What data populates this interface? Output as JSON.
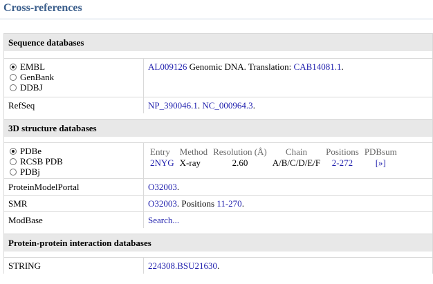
{
  "page_title": "Cross-references",
  "sections": [
    {
      "title": "Sequence databases",
      "rows": [
        {
          "radios": [
            {
              "label": "EMBL",
              "checked": true
            },
            {
              "label": "GenBank",
              "checked": false
            },
            {
              "label": "DDBJ",
              "checked": false
            }
          ],
          "link1": "AL009126",
          "text1": " Genomic DNA. Translation: ",
          "link2": "CAB14081.1",
          "text2": "."
        },
        {
          "label": "RefSeq",
          "link1": "NP_390046.1",
          "text1": ". ",
          "link2": "NC_000964.3",
          "text2": "."
        }
      ]
    },
    {
      "title": "3D structure databases",
      "radios": [
        {
          "label": "PDBe",
          "checked": true
        },
        {
          "label": "RCSB PDB",
          "checked": false
        },
        {
          "label": "PDBj",
          "checked": false
        }
      ],
      "table": {
        "headers": [
          "Entry",
          "Method",
          "Resolution (Å)",
          "Chain",
          "Positions",
          "PDBsum"
        ],
        "row": {
          "entry": "2NYG",
          "method": "X-ray",
          "resolution": "2.60",
          "chain": "A/B/C/D/E/F",
          "positions": "2-272",
          "pdbsum": "[»]"
        }
      },
      "rows": [
        {
          "label": "ProteinModelPortal",
          "link1": "O32003",
          "text1": "."
        },
        {
          "label": "SMR",
          "link1": "O32003",
          "text1": ". Positions ",
          "link2": "11-270",
          "text2": "."
        },
        {
          "label": "ModBase",
          "link1": "Search..."
        }
      ]
    },
    {
      "title": "Protein-protein interaction databases",
      "rows": [
        {
          "label": "STRING",
          "link1": "224308.BSU21630",
          "text1": "."
        }
      ]
    }
  ]
}
